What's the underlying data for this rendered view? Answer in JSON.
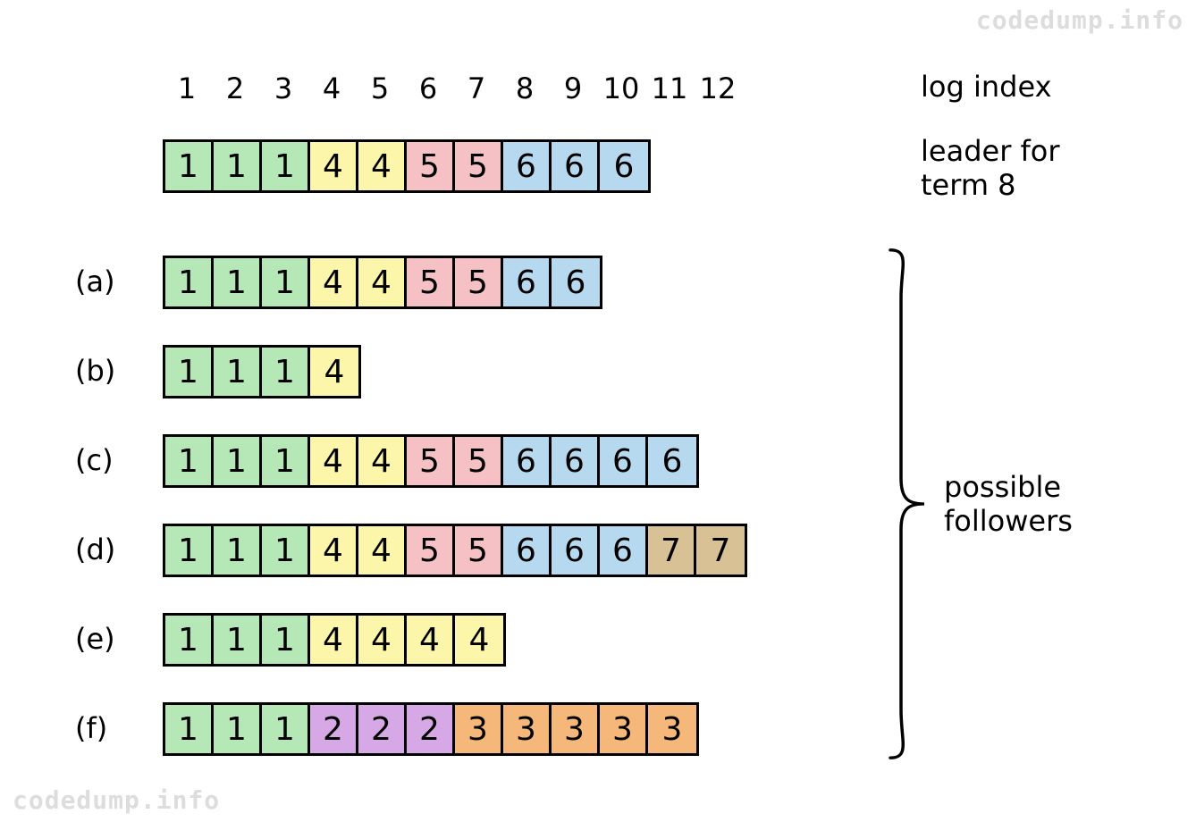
{
  "header": {
    "indices": [
      "1",
      "2",
      "3",
      "4",
      "5",
      "6",
      "7",
      "8",
      "9",
      "10",
      "11",
      "12"
    ],
    "right_label": "log index"
  },
  "leader": {
    "label": "leader for\nterm 8",
    "cells": [
      1,
      1,
      1,
      4,
      4,
      5,
      5,
      6,
      6,
      6
    ]
  },
  "followers_label": "possible\nfollowers",
  "rows": [
    {
      "tag": "(a)",
      "cells": [
        1,
        1,
        1,
        4,
        4,
        5,
        5,
        6,
        6
      ]
    },
    {
      "tag": "(b)",
      "cells": [
        1,
        1,
        1,
        4
      ]
    },
    {
      "tag": "(c)",
      "cells": [
        1,
        1,
        1,
        4,
        4,
        5,
        5,
        6,
        6,
        6,
        6
      ]
    },
    {
      "tag": "(d)",
      "cells": [
        1,
        1,
        1,
        4,
        4,
        5,
        5,
        6,
        6,
        6,
        7,
        7
      ]
    },
    {
      "tag": "(e)",
      "cells": [
        1,
        1,
        1,
        4,
        4,
        4,
        4
      ]
    },
    {
      "tag": "(f)",
      "cells": [
        1,
        1,
        1,
        2,
        2,
        2,
        3,
        3,
        3,
        3,
        3
      ]
    }
  ],
  "colors": {
    "1": "#b6e7b6",
    "2": "#d7a8e6",
    "3": "#f6b77a",
    "4": "#fbf6a9",
    "5": "#f6c1c5",
    "6": "#b6d9ef",
    "7": "#d8c194"
  },
  "watermark": "codedump.info",
  "layout": {
    "cellW": 54,
    "startX": 182,
    "indexY": 80,
    "leaderY": 156,
    "rowStartY": 286,
    "rowGap": 100,
    "rightLabelX": 1030,
    "labelX": 84,
    "braceX": 990,
    "braceTop": 276,
    "braceH": 576
  }
}
